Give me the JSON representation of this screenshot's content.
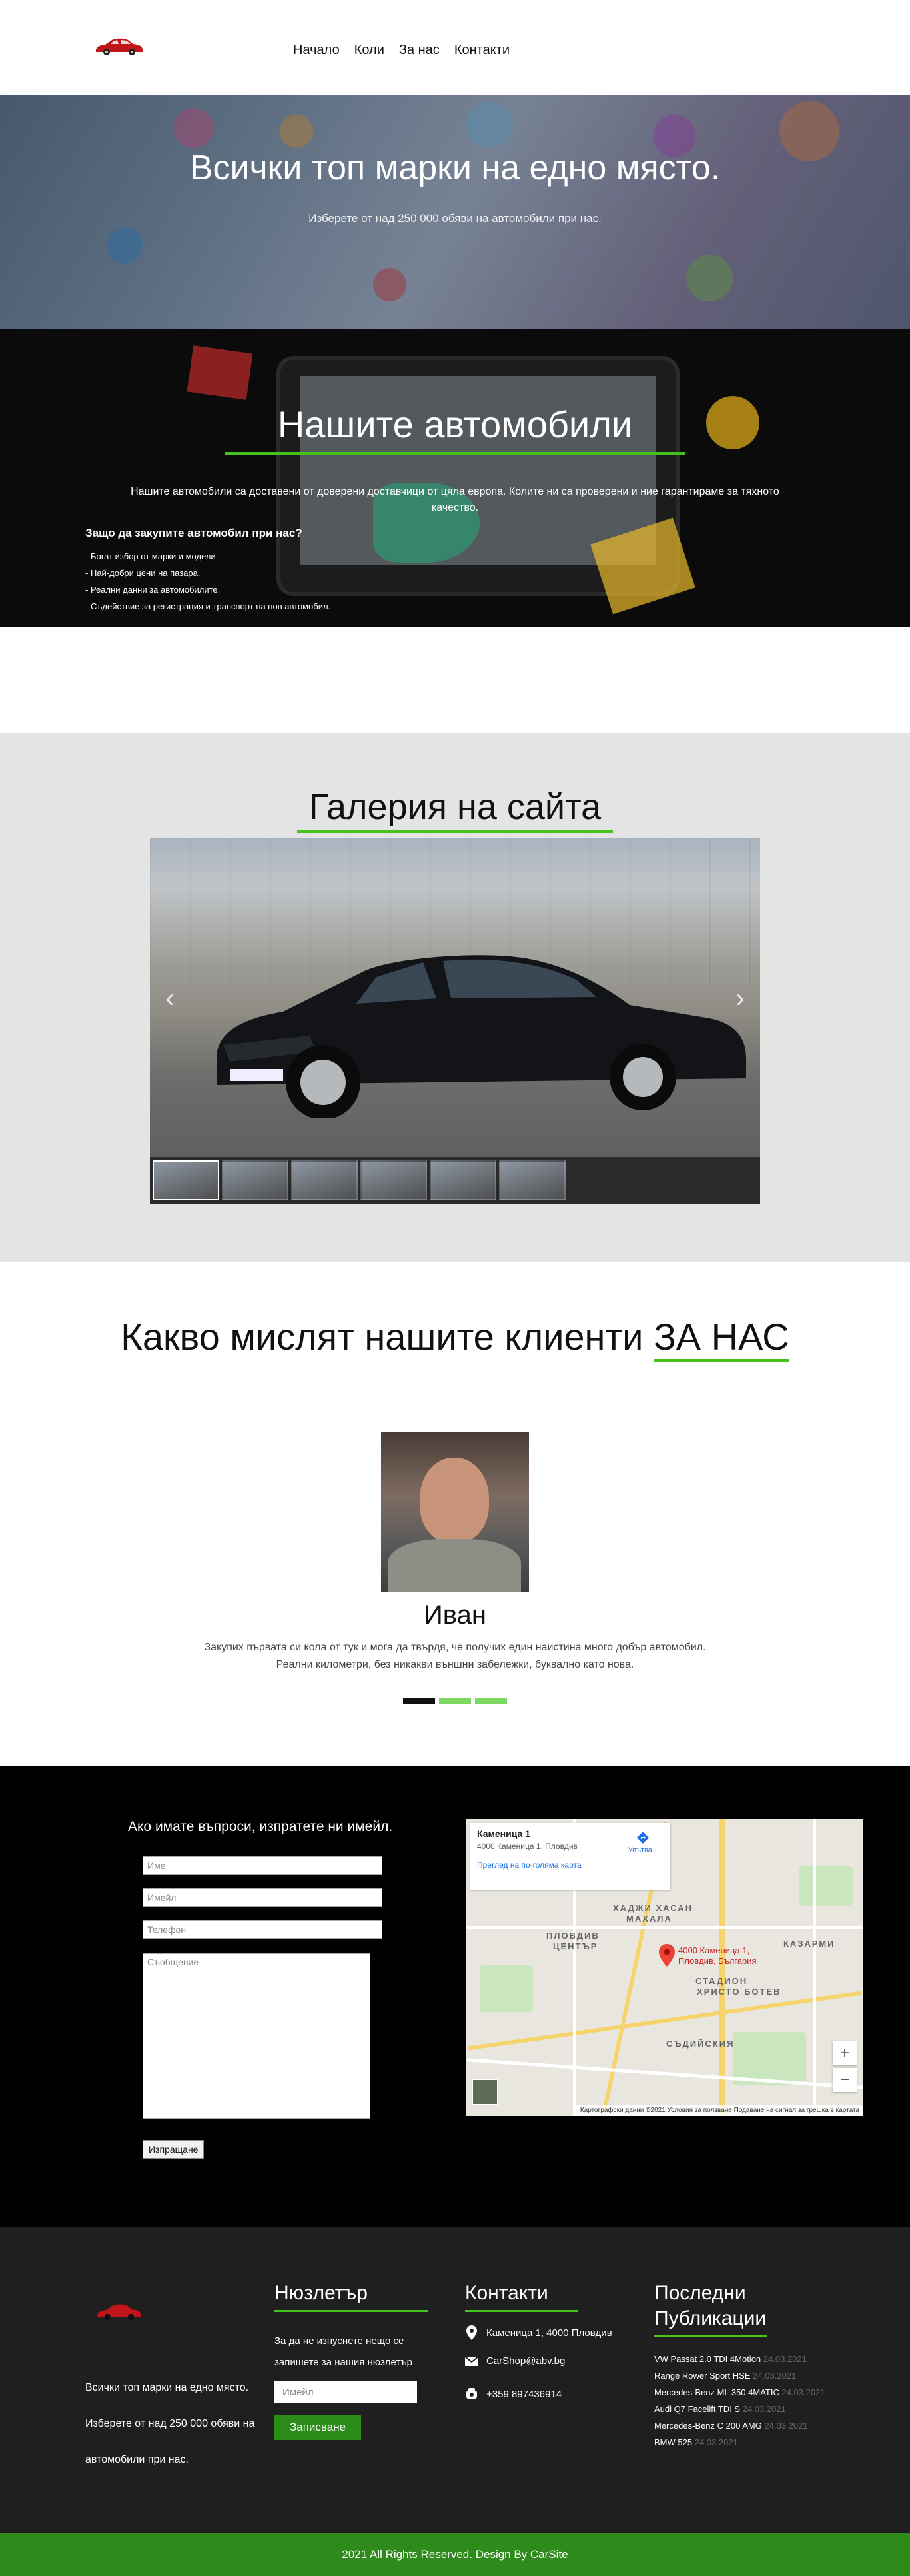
{
  "header": {
    "nav": [
      "Начало",
      "Коли",
      "За нас",
      "Контакти"
    ]
  },
  "hero": {
    "title": "Всички топ марки на едно място.",
    "subtitle": "Изберете от над 250 000 обяви на автомобили при нас."
  },
  "cars": {
    "title": "Нашите автомобили",
    "intro": "Нашите автомобили са доставени от доверени доставчици от цяла европа. Колите ни са проверени и ние гарантираме за тяхното качество.",
    "why_title": "Защо да закупите автомобил при нас?",
    "reasons": [
      "- Богат избор от марки и модели.",
      "- Най-добри цени на пазара.",
      "- Реални данни за автомобилите.",
      "- Съдействие за регистрация и транспорт на нов автомобил."
    ]
  },
  "gallery": {
    "title": "Галерия на сайта",
    "thumb_count": 6
  },
  "testimonials": {
    "title_prefix": "Какво мислят нашите клиенти ",
    "title_highlight": "ЗА НАС",
    "name": "Иван",
    "quote": "Закупих първата си кола от тук и мога да твърдя, че получих един наистина много добър автомобил. Реални километри, без никакви външни забележки, буквално като нова."
  },
  "contact": {
    "question": "Ако имате въпроси, изпратете ни имейл.",
    "placeholders": {
      "name": "Име",
      "email": "Имейл",
      "phone": "Телефон",
      "message": "Съобщение"
    },
    "send_label": "Изпращане",
    "map": {
      "place_title": "Каменица 1",
      "place_address": "4000 Каменица 1, Пловдив",
      "directions": "Упътва...",
      "larger_map": "Преглед на по-голяма карта",
      "pin_label_1": "4000 Каменица 1,",
      "pin_label_2": "Пловдив, България",
      "areas": [
        "ХАДЖИ ХАСАН",
        "МАХАЛА",
        "ПЛОВДИВ",
        "ЦЕНТЪР",
        "КАЗАРМИ",
        "СТАДИОН",
        "ХРИСТО БОТЕВ",
        "СЪДИЙСКИЯ"
      ],
      "footer_text": "Картографски данни ©2021   Условия за ползване   Подаване на сигнал за грешка в картата"
    }
  },
  "footer": {
    "about": [
      "Всички топ марки на едно място.",
      "Изберете от над 250 000 обяви на",
      "автомобили при нас."
    ],
    "newsletter": {
      "title": "Нюзлетър",
      "text": "За да не изпуснете нещо се запишете за нашия нюзлетър",
      "placeholder": "Имейл",
      "button": "Записване"
    },
    "contacts": {
      "title": "Контакти",
      "address": "Каменица 1, 4000 Пловдив",
      "email": "CarShop@abv.bg",
      "phone": "+359 897436914"
    },
    "posts": {
      "title_1": "Последни",
      "title_2": "Публикации",
      "items": [
        {
          "name": "VW Passat 2.0 TDI 4Motion",
          "date": "24.03.2021"
        },
        {
          "name": "Range Rower Sport HSE",
          "date": "24.03.2021"
        },
        {
          "name": "Mercedes-Benz ML 350 4MATIC",
          "date": "24.03.2021"
        },
        {
          "name": "Audi Q7 Facelift TDI S",
          "date": "24.03.2021"
        },
        {
          "name": "Mercedes-Benz C 200 AMG",
          "date": "24.03.2021"
        },
        {
          "name": "BMW 525",
          "date": "24.03.2021"
        }
      ]
    },
    "copyright": "2021 All Rights Reserved. Design By CarSite"
  },
  "colors": {
    "accent": "#46c21d",
    "footer_bar": "#2e8a1a",
    "dark": "#0b0b0b",
    "logo": "#c0151b"
  }
}
